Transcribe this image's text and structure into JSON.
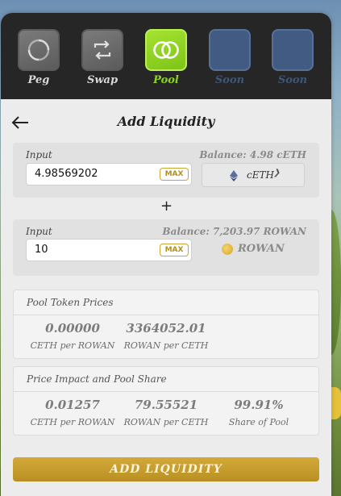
{
  "nav": {
    "tabs": [
      {
        "label": "Peg",
        "icon": "circle-refresh-icon"
      },
      {
        "label": "Swap",
        "icon": "swap-arrows-icon"
      },
      {
        "label": "Pool",
        "icon": "linked-rings-icon"
      },
      {
        "label": "Soon",
        "icon": "blank-tile"
      },
      {
        "label": "Soon",
        "icon": "blank-tile"
      }
    ],
    "active": "Pool"
  },
  "header": {
    "title": "Add Liquidity"
  },
  "input1": {
    "label": "Input",
    "balance": "Balance: 4.98 cETH",
    "value": "4.98569202",
    "max_label": "MAX",
    "token": "cETH",
    "token_icon": "ethereum-icon"
  },
  "plus_sign": "+",
  "input2": {
    "label": "Input",
    "balance": "Balance: 7,203.97 ROWAN",
    "value": "10",
    "max_label": "MAX",
    "token": "ROWAN",
    "token_icon": "rowan-coin-icon"
  },
  "pool_prices": {
    "title": "Pool Token Prices",
    "stats": [
      {
        "value": "0.00000",
        "label": "CETH per ROWAN"
      },
      {
        "value": "3364052.01",
        "label": "ROWAN per CETH"
      }
    ]
  },
  "price_impact": {
    "title": "Price Impact and Pool Share",
    "stats": [
      {
        "value": "0.01257",
        "label": "CETH per ROWAN"
      },
      {
        "value": "79.55521",
        "label": "ROWAN per CETH"
      },
      {
        "value": "99.91%",
        "label": "Share of Pool"
      }
    ]
  },
  "action": {
    "label": "ADD LIQUIDITY"
  },
  "colors": {
    "active_tab": "#8cd51f",
    "soon_tab": "#425b82",
    "accent_gold": "#c9a030"
  }
}
